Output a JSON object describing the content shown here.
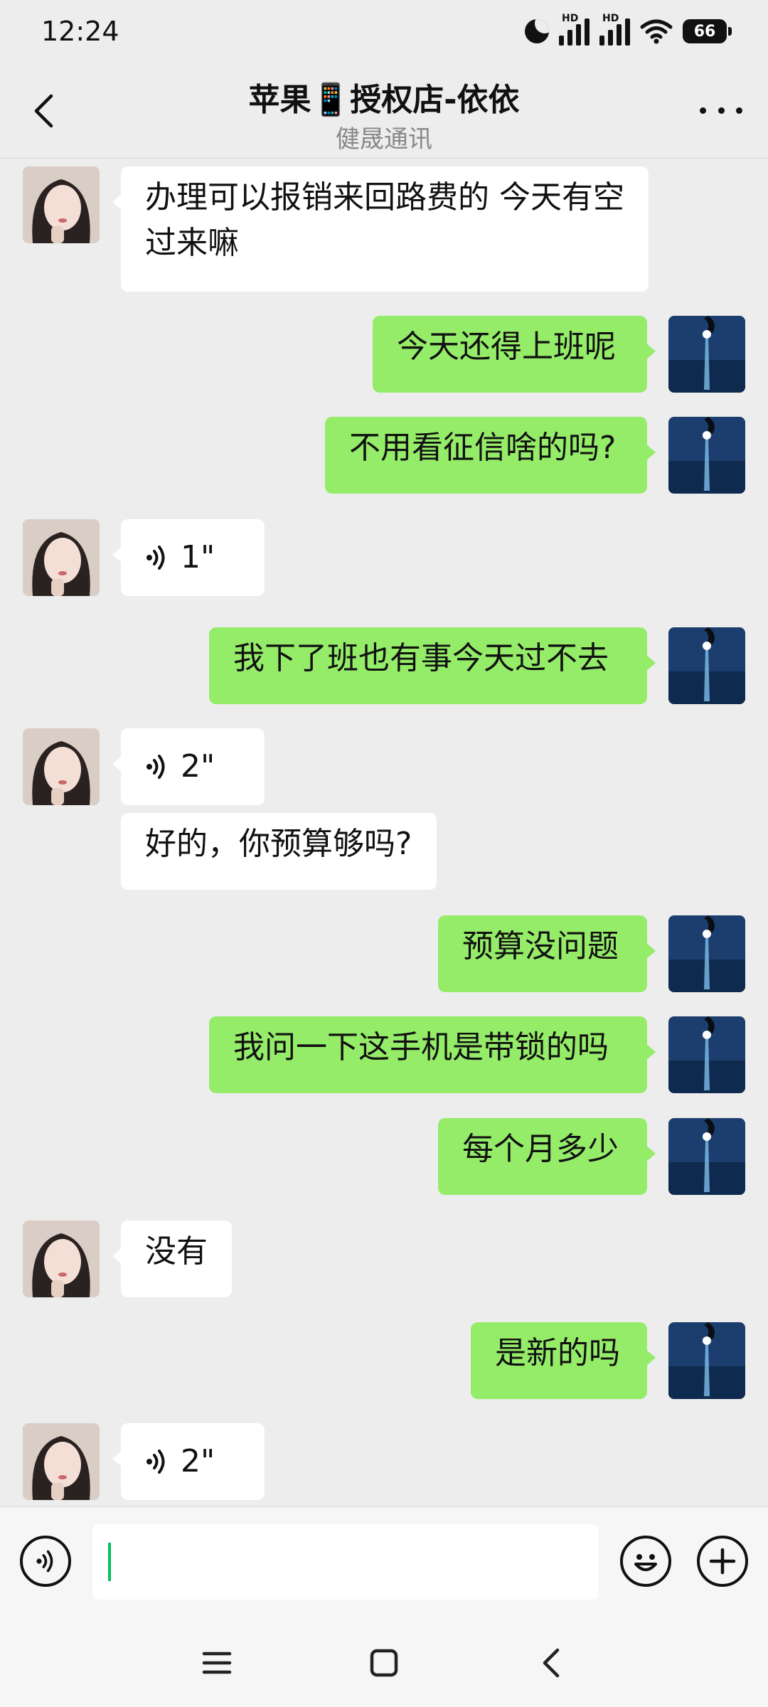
{
  "status": {
    "time": "12:24",
    "battery": "66",
    "hd1": "HD",
    "hd2": "HD"
  },
  "header": {
    "title": "苹果📱授权店-依依",
    "subtitle": "健晟通讯"
  },
  "messages": [
    {
      "side": "left",
      "type": "text",
      "text": "办理可以报销来回路费的  今天有空过来嘛"
    },
    {
      "side": "right",
      "type": "text",
      "text": "今天还得上班呢"
    },
    {
      "side": "right",
      "type": "text",
      "text": "不用看征信啥的吗?"
    },
    {
      "side": "left",
      "type": "voice",
      "text": "1\""
    },
    {
      "side": "right",
      "type": "text",
      "text": "我下了班也有事今天过不去"
    },
    {
      "side": "left",
      "type": "voice",
      "text": "2\""
    },
    {
      "side": "left",
      "type": "text",
      "text": "好的，你预算够吗?"
    },
    {
      "side": "right",
      "type": "text",
      "text": "预算没问题"
    },
    {
      "side": "right",
      "type": "text",
      "text": "我问一下这手机是带锁的吗"
    },
    {
      "side": "right",
      "type": "text",
      "text": "每个月多少"
    },
    {
      "side": "left",
      "type": "text",
      "text": "没有"
    },
    {
      "side": "right",
      "type": "text",
      "text": "是新的吗"
    },
    {
      "side": "left",
      "type": "voice",
      "text": "2\""
    }
  ],
  "input": {
    "value": ""
  },
  "colors": {
    "background": "#ededed",
    "bubble_self": "#95ec69",
    "bubble_other": "#ffffff",
    "cursor": "#07c160"
  }
}
